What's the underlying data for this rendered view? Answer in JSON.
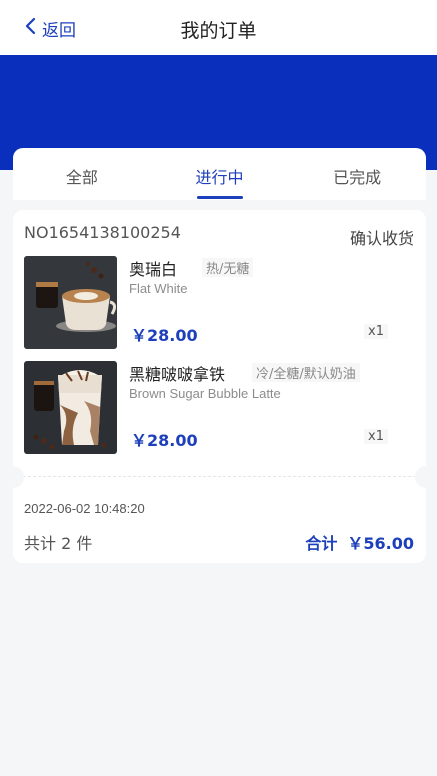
{
  "header": {
    "back_label": "返回",
    "title": "我的订单"
  },
  "tabs": [
    {
      "label": "全部",
      "active": false
    },
    {
      "label": "进行中",
      "active": true
    },
    {
      "label": "已完成",
      "active": false
    }
  ],
  "order": {
    "number": "NO1654138100254",
    "action_label": "确认收货",
    "items": [
      {
        "name": "奥瑞白",
        "spec": "热/无糖",
        "name_en": "Flat White",
        "price": "￥28.00",
        "qty": "x1",
        "image": "flat-white-coffee-photo"
      },
      {
        "name": "黑糖啵啵拿铁",
        "spec": "冷/全糖/默认奶油",
        "name_en": "Brown Sugar Bubble Latte",
        "price": "￥28.00",
        "qty": "x1",
        "image": "brown-sugar-bubble-latte-photo"
      }
    ],
    "time": "2022-06-02 10:48:20",
    "count_text": "共计 2 件",
    "total_label": "合计",
    "total_value": "￥56.00"
  },
  "colors": {
    "accent": "#1d3fbb",
    "banner": "#0b2fbd",
    "background": "#f5f6f8"
  },
  "icons": {
    "back": "chevron-left-icon"
  }
}
